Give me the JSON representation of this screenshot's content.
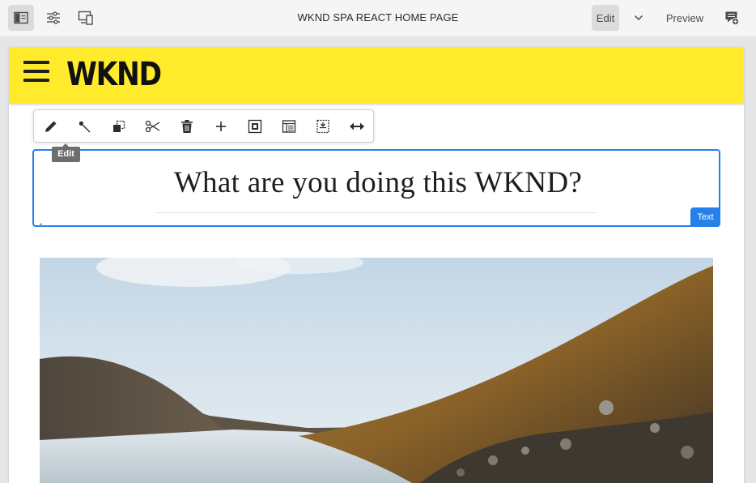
{
  "editor": {
    "title": "WKND SPA REACT HOME PAGE",
    "edit_label": "Edit",
    "preview_label": "Preview",
    "icons": [
      "side-panel-icon",
      "page-properties-icon",
      "emulator-icon",
      "chevron-down-icon",
      "annotations-icon"
    ]
  },
  "site": {
    "logo_text": "WKND",
    "header_color": "#ffea2c"
  },
  "component_toolbar": {
    "tooltip": "Edit",
    "actions": [
      "pencil-icon",
      "wrench-icon",
      "copy-icon",
      "cut-icon",
      "trash-icon",
      "plus-icon",
      "group-icon",
      "layout-icon",
      "parent-icon",
      "resize-icon"
    ]
  },
  "text_component": {
    "heading": "What are you doing this WKND?",
    "badge": "Text",
    "selection_color": "#2680eb"
  },
  "hero_image": {
    "description_name": "mountain-lake-image"
  }
}
